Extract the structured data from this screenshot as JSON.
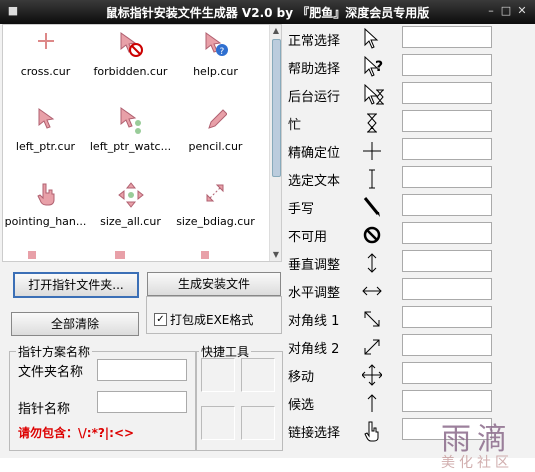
{
  "window": {
    "title": "鼠标指针安装文件生成器 V2.0  by 『肥鱼』深度会员专用版"
  },
  "files": [
    {
      "name": "cross.cur",
      "icon": "cross-cursor-icon"
    },
    {
      "name": "forbidden.cur",
      "icon": "forbidden-cursor-icon"
    },
    {
      "name": "help.cur",
      "icon": "help-cursor-icon"
    },
    {
      "name": "left_ptr.cur",
      "icon": "arrow-cursor-icon"
    },
    {
      "name": "left_ptr_watc...",
      "icon": "arrow-wait-cursor-icon"
    },
    {
      "name": "pencil.cur",
      "icon": "pencil-cursor-icon"
    },
    {
      "name": "pointing_han...",
      "icon": "hand-cursor-icon"
    },
    {
      "name": "size_all.cur",
      "icon": "move-cursor-icon"
    },
    {
      "name": "size_bdiag.cur",
      "icon": "diagonal-resize-cursor-icon"
    }
  ],
  "buttons": {
    "open_folder": "打开指针文件夹...",
    "generate": "生成安装文件",
    "clear_all": "全部清除",
    "pack_exe": "打包成EXE格式"
  },
  "form": {
    "group_title": "指针方案名称",
    "folder_label": "文件夹名称",
    "pointer_label": "指针名称",
    "warning": "请勿包含：\\/:*?|:<>",
    "folder_value": "",
    "pointer_value": ""
  },
  "shortcuts": {
    "title": "快捷工具"
  },
  "cursor_roles": [
    {
      "label": "正常选择",
      "icon": "arrow-icon"
    },
    {
      "label": "帮助选择",
      "icon": "help-select-icon"
    },
    {
      "label": "后台运行",
      "icon": "working-background-icon"
    },
    {
      "label": "忙",
      "icon": "busy-hourglass-icon"
    },
    {
      "label": "精确定位",
      "icon": "precision-crosshair-icon"
    },
    {
      "label": "选定文本",
      "icon": "text-ibeam-icon"
    },
    {
      "label": "手写",
      "icon": "handwriting-pen-icon"
    },
    {
      "label": "不可用",
      "icon": "unavailable-icon"
    },
    {
      "label": "垂直调整",
      "icon": "vertical-resize-icon"
    },
    {
      "label": "水平调整",
      "icon": "horizontal-resize-icon"
    },
    {
      "label": "对角线 1",
      "icon": "diagonal-resize-1-icon"
    },
    {
      "label": "对角线 2",
      "icon": "diagonal-resize-2-icon"
    },
    {
      "label": "移动",
      "icon": "move-icon"
    },
    {
      "label": "候选",
      "icon": "alternate-select-icon"
    },
    {
      "label": "链接选择",
      "icon": "link-hand-icon"
    }
  ],
  "watermark": {
    "line1": "雨滴",
    "line2": "美化社区"
  }
}
